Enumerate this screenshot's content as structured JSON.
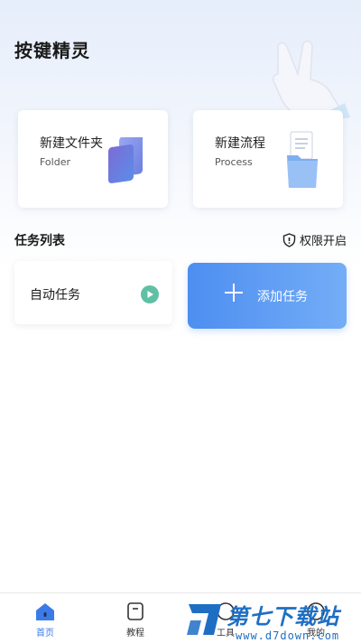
{
  "app": {
    "title": "按键精灵"
  },
  "cards": {
    "folder": {
      "title": "新建文件夹",
      "subtitle": "Folder"
    },
    "process": {
      "title": "新建流程",
      "subtitle": "Process"
    }
  },
  "tasks": {
    "section_title": "任务列表",
    "permission_label": "权限开启",
    "items": [
      {
        "label": "自动任务",
        "icon": "play-icon"
      }
    ],
    "add_label": "添加任务"
  },
  "nav": {
    "items": [
      {
        "label": "首页",
        "icon": "home-icon",
        "active": true
      },
      {
        "label": "教程",
        "icon": "book-icon",
        "active": false
      },
      {
        "label": "工具",
        "icon": "tool-icon",
        "active": false
      },
      {
        "label": "我的",
        "icon": "user-icon",
        "active": false
      }
    ]
  },
  "watermark": {
    "text": "第七下载站",
    "url": "www.d7down.com"
  },
  "colors": {
    "accent": "#4d8ef0",
    "play": "#5fc0a6",
    "nav_active": "#3b7be8"
  }
}
